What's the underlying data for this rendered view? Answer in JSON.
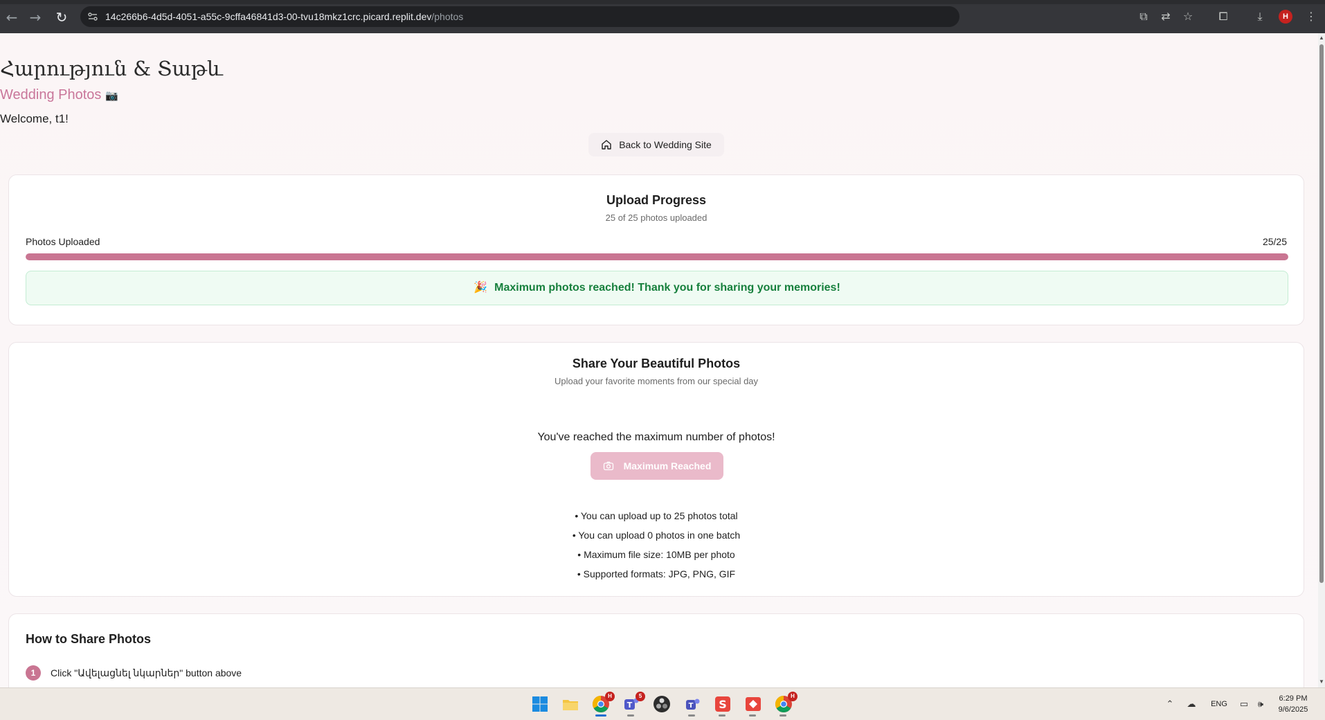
{
  "browser": {
    "url_host": "14c266b6-4d5d-4051-a55c-9cffa46841d3-00-tvu18mkz1crc.picard.replit.dev",
    "url_path": "/photos",
    "profile_initial": "H"
  },
  "header": {
    "title": "Հարություն & Տաթև",
    "subtitle": "Wedding Photos",
    "subtitle_emoji": "📷",
    "welcome": "Welcome, t1!",
    "back_button": "Back to Wedding Site"
  },
  "upload_progress": {
    "title": "Upload Progress",
    "summary": "25 of 25 photos uploaded",
    "label": "Photos Uploaded",
    "count": "25/25",
    "fraction": 1.0,
    "notice_emoji": "🎉",
    "notice": "Maximum photos reached! Thank you for sharing your memories!"
  },
  "share": {
    "title": "Share Your Beautiful Photos",
    "subtitle": "Upload your favorite moments from our special day",
    "max_message": "You've reached the maximum number of photos!",
    "button_label": "Maximum Reached",
    "rules": [
      "• You can upload up to 25 photos total",
      "• You can upload 0 photos in one batch",
      "• Maximum file size: 10MB per photo",
      "• Supported formats: JPG, PNG, GIF"
    ]
  },
  "howto": {
    "title": "How to Share Photos",
    "steps": [
      {
        "num": "1",
        "text": "Click \"Ավելացնել նկարներ\" button above"
      }
    ]
  },
  "taskbar": {
    "language": "ENG",
    "time": "6:29 PM",
    "date": "9/6/2025",
    "chrome_badge": "H",
    "teams_badge": "5"
  },
  "colors": {
    "accent": "#c97592",
    "success_text": "#17803d",
    "success_bg": "#effbf3"
  }
}
